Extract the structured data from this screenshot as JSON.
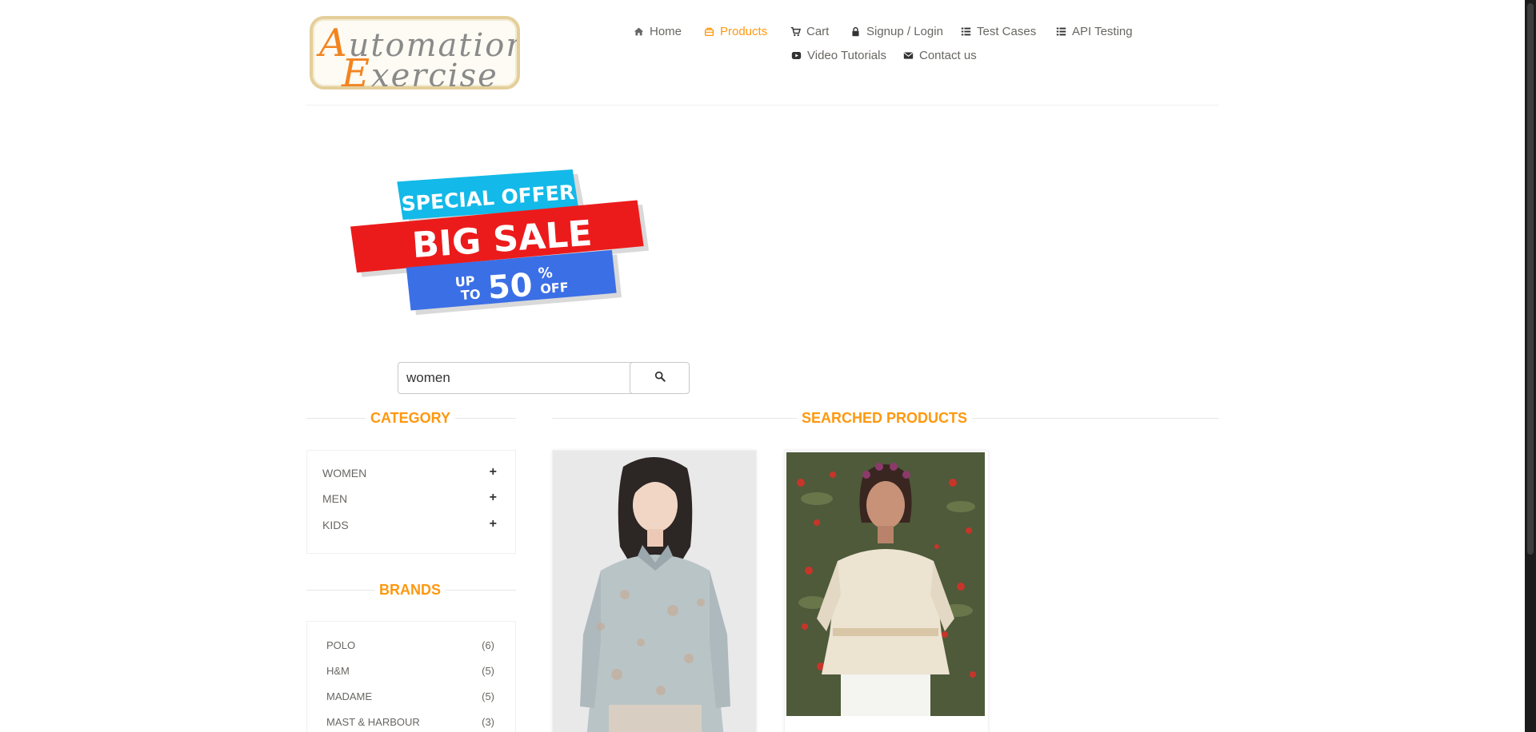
{
  "header": {
    "logo": {
      "line1": "Automation",
      "line2": "Exercise"
    },
    "nav": [
      {
        "label": "Home",
        "icon": "home-icon"
      },
      {
        "label": "Products",
        "icon": "products-icon",
        "active": true
      },
      {
        "label": "Cart",
        "icon": "cart-icon"
      },
      {
        "label": "Signup / Login",
        "icon": "lock-icon"
      },
      {
        "label": "Test Cases",
        "icon": "list-icon"
      },
      {
        "label": "API Testing",
        "icon": "list-icon"
      },
      {
        "label": "Video Tutorials",
        "icon": "youtube-icon"
      },
      {
        "label": "Contact us",
        "icon": "envelope-icon"
      }
    ]
  },
  "banner": {
    "line1": "SPECIAL OFFER",
    "line2": "BIG SALE",
    "up": "UP",
    "to": "TO",
    "pct": "50",
    "pct_sign": "%",
    "off": "OFF"
  },
  "search": {
    "value": "women",
    "button_icon": "search-icon"
  },
  "sidebar": {
    "category_title": "CATEGORY",
    "categories": [
      {
        "label": "WOMEN",
        "toggle": "+"
      },
      {
        "label": "MEN",
        "toggle": "+"
      },
      {
        "label": "KIDS",
        "toggle": "+"
      }
    ],
    "brands_title": "BRANDS",
    "brands": [
      {
        "label": "POLO",
        "count": "(6)"
      },
      {
        "label": "H&M",
        "count": "(5)"
      },
      {
        "label": "MADAME",
        "count": "(5)"
      },
      {
        "label": "MAST & HARBOUR",
        "count": "(3)"
      }
    ]
  },
  "main": {
    "title": "SEARCHED PRODUCTS"
  },
  "colors": {
    "accent": "#fe980f",
    "text": "#696763"
  }
}
